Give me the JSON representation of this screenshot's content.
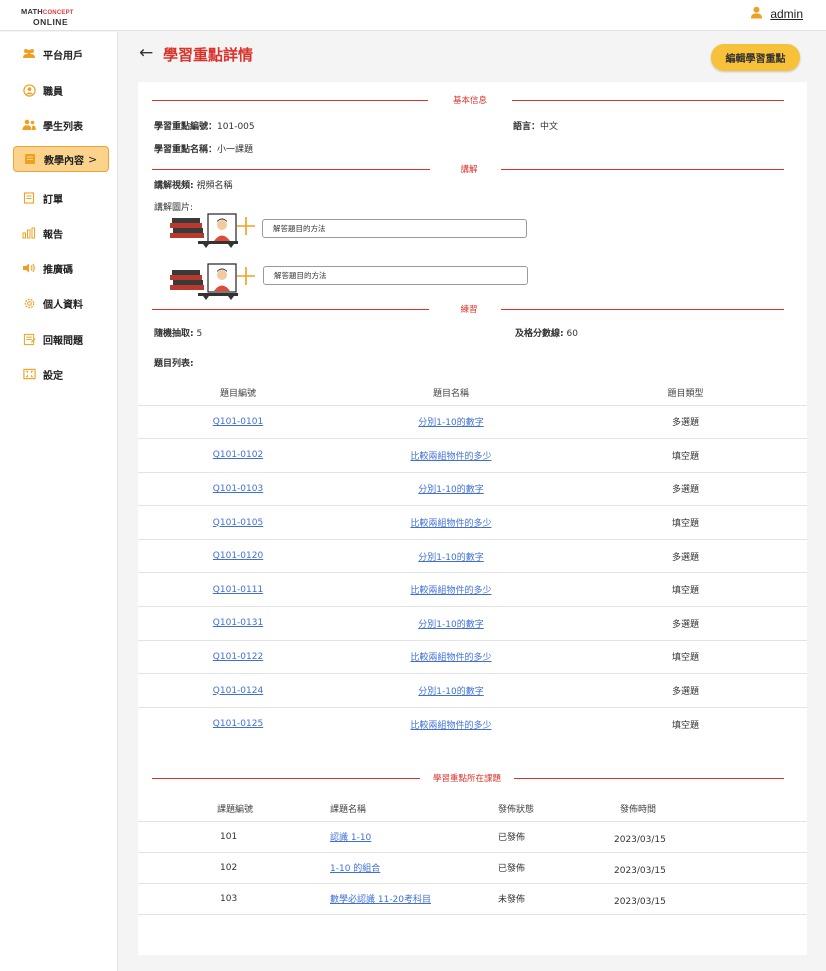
{
  "brand": {
    "line1_a": "MATH",
    "line1_b": "CONCEPT",
    "line2": "ONLINE"
  },
  "user": {
    "name": "admin"
  },
  "sidebar": {
    "items": [
      {
        "label": "平台用戶",
        "icon": "users-icon"
      },
      {
        "label": "職員",
        "icon": "staff-icon"
      },
      {
        "label": "學生列表",
        "icon": "students-icon"
      },
      {
        "label": "教學內容",
        "icon": "book-icon",
        "active": true,
        "chevron": ">"
      },
      {
        "label": "訂單",
        "icon": "order-icon"
      },
      {
        "label": "報告",
        "icon": "chart-icon"
      },
      {
        "label": "推廣碼",
        "icon": "speaker-icon"
      },
      {
        "label": "個人資料",
        "icon": "gear-icon"
      },
      {
        "label": "回報問題",
        "icon": "report-icon"
      },
      {
        "label": "設定",
        "icon": "settings-icon"
      }
    ]
  },
  "header": {
    "back": "←",
    "title": "學習重點詳情",
    "edit_button": "編輯學習重點"
  },
  "basic": {
    "section": "基本信息",
    "code_label": "學習重點編號：",
    "code_value": "101-005",
    "name_label": "學習重點名稱：",
    "name_value": "小一課題",
    "lang_label": "語言：",
    "lang_value": "中文"
  },
  "explain": {
    "section": "講解",
    "video_label": "講解視頻:",
    "video_value": "視頻名稱",
    "image_label": "講解圖片:",
    "images": [
      {
        "caption": "解答題目的方法"
      },
      {
        "caption": "解答題目的方法"
      }
    ]
  },
  "practice": {
    "section": "練習",
    "random_label": "隨機抽取:",
    "random_value": "5",
    "pass_label": "及格分數線:",
    "pass_value": "60",
    "list_label": "題目列表:",
    "headers": [
      "題目編號",
      "題目名稱",
      "題目類型"
    ],
    "rows": [
      {
        "code": "Q101-0101",
        "name": "分別1-10的數字",
        "type": "多選題"
      },
      {
        "code": "Q101-0102",
        "name": "比較兩組物件的多少",
        "type": "填空題"
      },
      {
        "code": "Q101-0103",
        "name": "分別1-10的數字",
        "type": "多選題"
      },
      {
        "code": "Q101-0105",
        "name": "比較兩組物件的多少",
        "type": "填空題"
      },
      {
        "code": "Q101-0120",
        "name": "分別1-10的數字",
        "type": "多選題"
      },
      {
        "code": "Q101-0111",
        "name": "比較兩組物件的多少",
        "type": "填空題"
      },
      {
        "code": "Q101-0131",
        "name": "分別1-10的數字",
        "type": "多選題"
      },
      {
        "code": "Q101-0122",
        "name": "比較兩組物件的多少",
        "type": "填空題"
      },
      {
        "code": "Q101-0124",
        "name": "分別1-10的數字",
        "type": "多選題"
      },
      {
        "code": "Q101-0125",
        "name": "比較兩組物件的多少",
        "type": "填空題"
      }
    ]
  },
  "courses": {
    "section": "學習重點所在課題",
    "headers": [
      "課題編號",
      "課題名稱",
      "發佈狀態",
      "發佈時間"
    ],
    "rows": [
      {
        "code": "101",
        "name": "認識 1-10",
        "status": "已發佈",
        "date": "2023/03/15"
      },
      {
        "code": "102",
        "name": "1-10 的組合",
        "status": "已發佈",
        "date": "2023/03/15"
      },
      {
        "code": "103",
        "name": "數學必認識 11-20考科目",
        "status": "未發佈",
        "date": "2023/03/15"
      }
    ]
  }
}
